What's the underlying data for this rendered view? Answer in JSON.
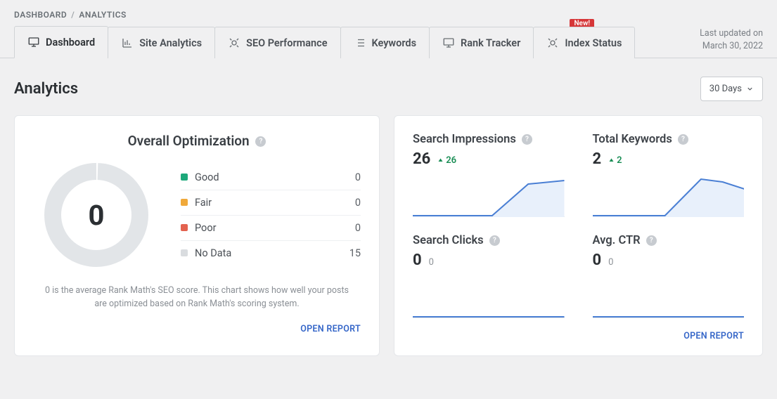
{
  "breadcrumb": {
    "root": "DASHBOARD",
    "current": "ANALYTICS"
  },
  "badge_new": "New!",
  "tabs": [
    {
      "label": "Dashboard"
    },
    {
      "label": "Site Analytics"
    },
    {
      "label": "SEO Performance"
    },
    {
      "label": "Keywords"
    },
    {
      "label": "Rank Tracker"
    },
    {
      "label": "Index Status"
    }
  ],
  "last_updated": {
    "label": "Last updated on",
    "date": "March 30, 2022"
  },
  "page_title": "Analytics",
  "range_select": "30 Days",
  "optimization": {
    "title": "Overall Optimization",
    "score": "0",
    "legend": [
      {
        "label": "Good",
        "value": "0",
        "color": "#1da87a"
      },
      {
        "label": "Fair",
        "value": "0",
        "color": "#f0a93a"
      },
      {
        "label": "Poor",
        "value": "0",
        "color": "#e3624f"
      },
      {
        "label": "No Data",
        "value": "15",
        "color": "#d9dcdf"
      }
    ],
    "desc": "0 is the average Rank Math's SEO score. This chart shows how well your posts are optimized based on Rank Math's scoring system.",
    "open_report": "OPEN REPORT"
  },
  "stats": {
    "impressions": {
      "title": "Search Impressions",
      "value": "26",
      "delta": "26"
    },
    "keywords": {
      "title": "Total Keywords",
      "value": "2",
      "delta": "2"
    },
    "clicks": {
      "title": "Search Clicks",
      "value": "0",
      "sub": "0"
    },
    "ctr": {
      "title": "Avg. CTR",
      "value": "0",
      "sub": "0"
    },
    "open_report": "OPEN REPORT"
  },
  "chart_data": [
    {
      "type": "pie",
      "title": "Overall Optimization",
      "series": [
        {
          "name": "Good",
          "value": 0,
          "color": "#1da87a"
        },
        {
          "name": "Fair",
          "value": 0,
          "color": "#f0a93a"
        },
        {
          "name": "Poor",
          "value": 0,
          "color": "#e3624f"
        },
        {
          "name": "No Data",
          "value": 15,
          "color": "#d9dcdf"
        }
      ],
      "center_label": 0
    },
    {
      "type": "area",
      "title": "Search Impressions",
      "x": [
        0,
        1,
        2,
        3,
        4,
        5,
        6
      ],
      "values": [
        0,
        0,
        0,
        0,
        20,
        26,
        26
      ],
      "ylim": [
        0,
        26
      ]
    },
    {
      "type": "area",
      "title": "Total Keywords",
      "x": [
        0,
        1,
        2,
        3,
        4,
        5,
        6
      ],
      "values": [
        0,
        0,
        0,
        0,
        2,
        2,
        1.5
      ],
      "ylim": [
        0,
        2
      ]
    },
    {
      "type": "line",
      "title": "Search Clicks",
      "x": [
        0,
        1,
        2,
        3,
        4,
        5,
        6
      ],
      "values": [
        0,
        0,
        0,
        0,
        0,
        0,
        0
      ],
      "ylim": [
        0,
        1
      ]
    },
    {
      "type": "line",
      "title": "Avg. CTR",
      "x": [
        0,
        1,
        2,
        3,
        4,
        5,
        6
      ],
      "values": [
        0,
        0,
        0,
        0,
        0,
        0,
        0
      ],
      "ylim": [
        0,
        1
      ]
    }
  ]
}
